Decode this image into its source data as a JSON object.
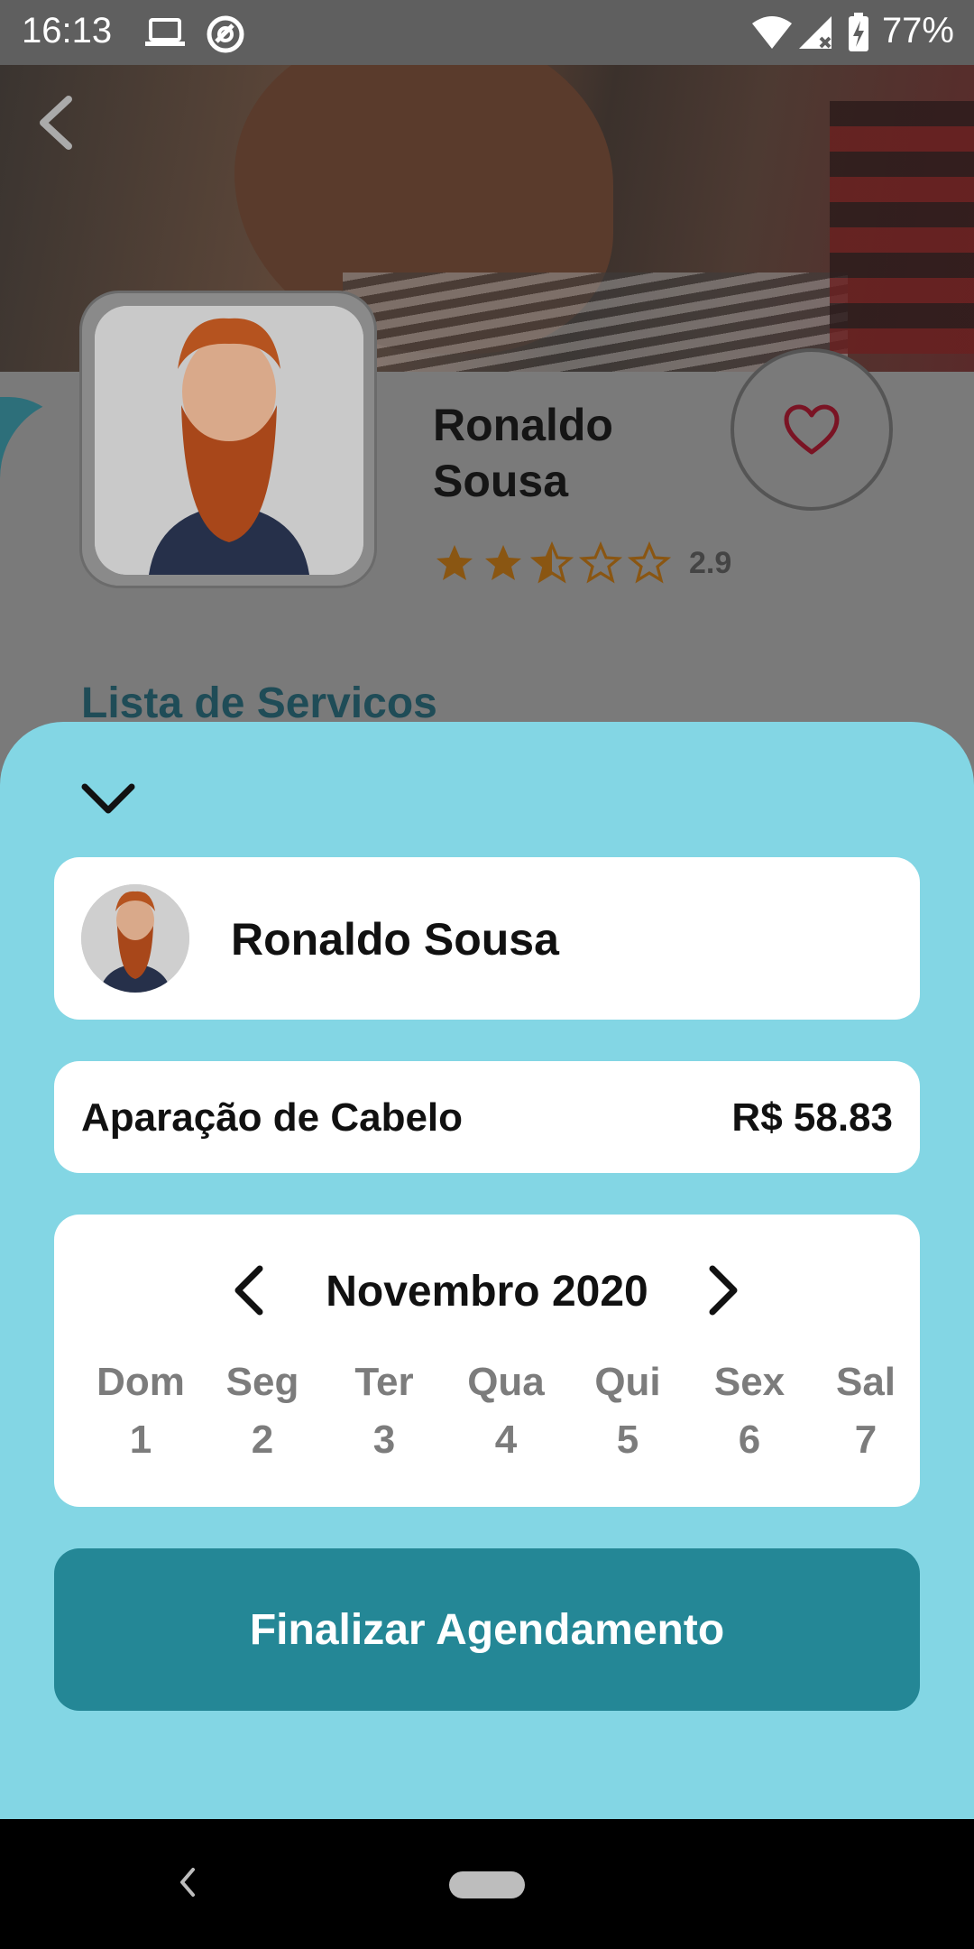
{
  "status_bar": {
    "time": "16:13",
    "battery_percent": "77%",
    "icons": [
      "laptop-icon",
      "vpn-icon",
      "wifi-icon",
      "signal-icon",
      "battery-charging-icon"
    ]
  },
  "header": {
    "back_icon": "chevron-left-icon"
  },
  "profile": {
    "name": "Ronaldo Sousa",
    "rating": 2.9,
    "rating_label": "2.9",
    "stars_max": 5,
    "favorite_icon": "heart-outline-icon"
  },
  "section": {
    "title": "Lista de Servicos"
  },
  "booking_sheet": {
    "collapse_icon": "chevron-down-icon",
    "barber_name": "Ronaldo Sousa",
    "service": {
      "name": "Aparação de Cabelo",
      "price": "R$ 58.83"
    },
    "calendar": {
      "month_label": "Novembro 2020",
      "prev_icon": "chevron-left-icon",
      "next_icon": "chevron-right-icon",
      "days": [
        {
          "name": "Dom",
          "date": "1"
        },
        {
          "name": "Seg",
          "date": "2"
        },
        {
          "name": "Ter",
          "date": "3"
        },
        {
          "name": "Qua",
          "date": "4"
        },
        {
          "name": "Qui",
          "date": "5"
        },
        {
          "name": "Sex",
          "date": "6"
        },
        {
          "name": "Sal",
          "date": "7"
        }
      ]
    },
    "finalize_label": "Finalizar Agendamento"
  },
  "colors": {
    "sheet_background": "#83d6e4",
    "primary_button": "#248796",
    "star": "#c97a12",
    "heart": "#8a1c2c"
  }
}
